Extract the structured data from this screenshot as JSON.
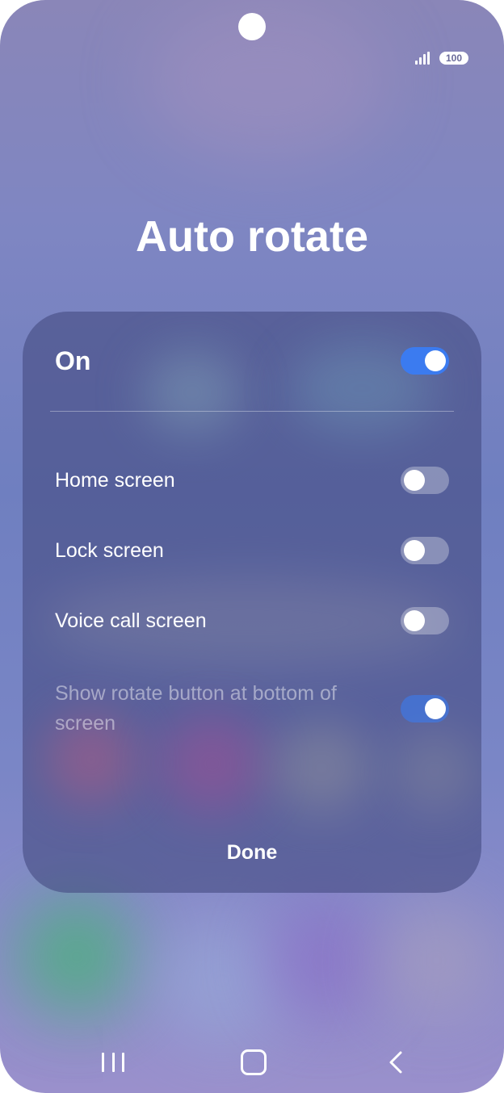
{
  "status_bar": {
    "battery_level": "100",
    "signal_icon": "signal-icon"
  },
  "dialog": {
    "title": "Auto rotate",
    "master_toggle": {
      "label": "On",
      "state": "on"
    },
    "options": [
      {
        "label": "Home screen",
        "state": "off"
      },
      {
        "label": "Lock screen",
        "state": "off"
      },
      {
        "label": "Voice call screen",
        "state": "off"
      },
      {
        "label": "Show rotate button at bottom of screen",
        "state": "on",
        "disabled": true
      }
    ],
    "done_label": "Done"
  },
  "navigation_bar": {
    "recents_icon": "recents-icon",
    "home_icon": "home-icon",
    "back_icon": "back-icon"
  },
  "colors": {
    "toggle_on": "#3b7bf0",
    "text": "#ffffff"
  }
}
